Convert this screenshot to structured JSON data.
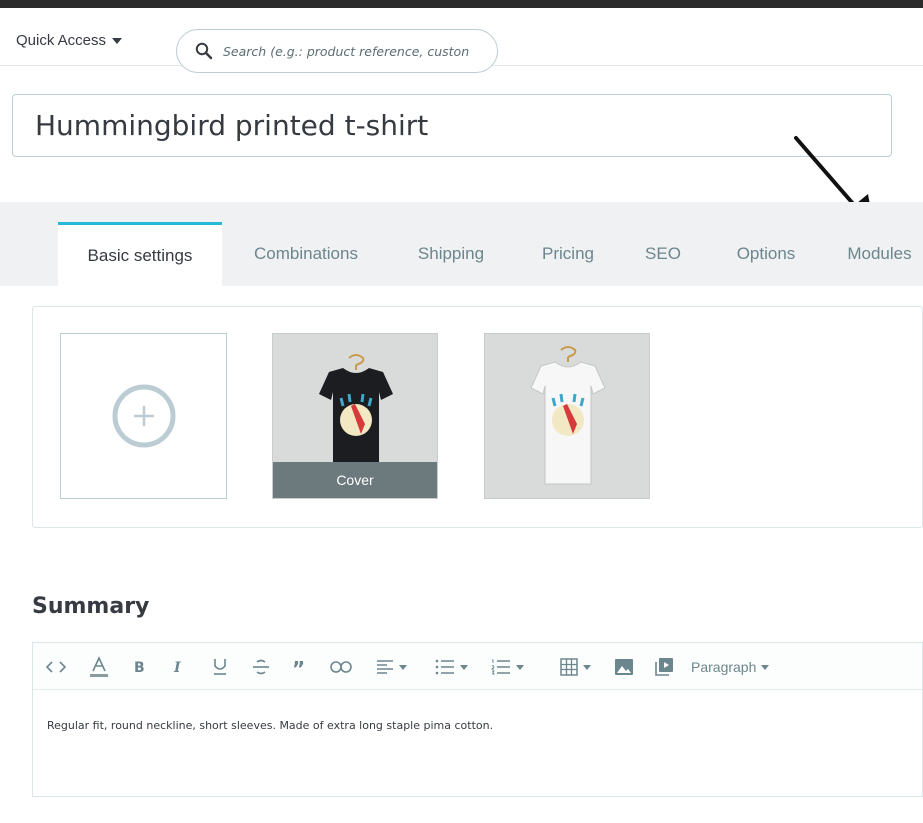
{
  "header": {
    "quick_access": "Quick Access",
    "search_placeholder": "Search (e.g.: product reference, custon"
  },
  "product": {
    "name": "Hummingbird printed t-shirt"
  },
  "tabs": [
    {
      "label": "Basic settings",
      "active": true
    },
    {
      "label": "Combinations"
    },
    {
      "label": "Shipping"
    },
    {
      "label": "Pricing"
    },
    {
      "label": "SEO"
    },
    {
      "label": "Options"
    },
    {
      "label": "Modules"
    }
  ],
  "images": {
    "cover_label": "Cover",
    "items": [
      {
        "shirt_color": "black",
        "is_cover": true
      },
      {
        "shirt_color": "white",
        "is_cover": false
      }
    ]
  },
  "summary": {
    "heading": "Summary",
    "paragraph_format": "Paragraph",
    "content": "Regular fit, round neckline, short sleeves. Made of extra long staple pima cotton."
  },
  "colors": {
    "accent": "#25b9d7",
    "text": "#363a41",
    "muted": "#6c868e",
    "border": "#bbcdd2"
  },
  "icons": {
    "search": "search-icon",
    "add": "plus-circle-icon",
    "annotation": "arrow-pointer-icon"
  }
}
